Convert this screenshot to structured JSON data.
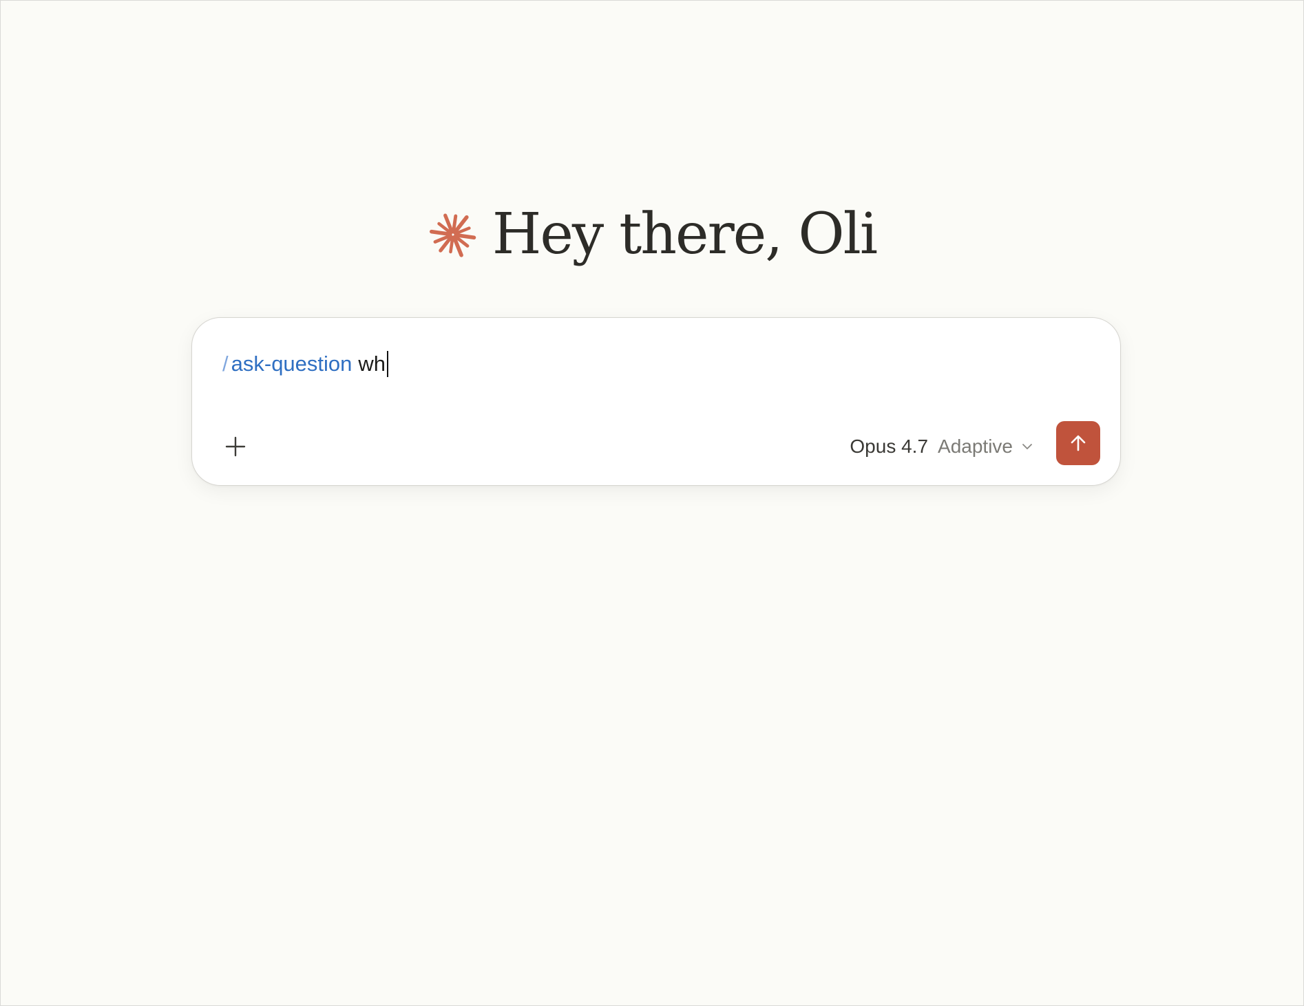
{
  "greeting": {
    "text": "Hey there, Oli",
    "logo_icon": "asterisk-burst-icon",
    "logo_color": "#d16c52"
  },
  "composer": {
    "command_slash": "/",
    "command": "ask-question",
    "typed_text": "wh",
    "add_icon": "plus-icon",
    "model": {
      "name": "Opus 4.7",
      "mode": "Adaptive",
      "chevron_icon": "chevron-down-icon"
    },
    "send": {
      "icon": "arrow-up-icon",
      "color": "#c0533c"
    }
  },
  "colors": {
    "background": "#fbfbf7",
    "command_blue": "#2f6fc2",
    "text_dark": "#2d2c28"
  }
}
